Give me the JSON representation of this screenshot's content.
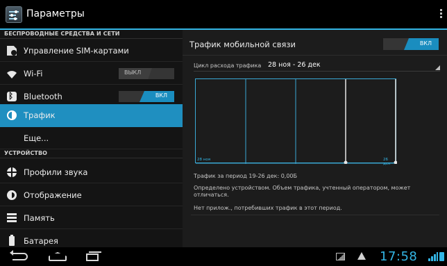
{
  "window": {
    "title": "Параметры",
    "overflow_icon": "overflow-menu-icon"
  },
  "sections": {
    "wireless": "БЕСПРОВОДНЫЕ СРЕДСТВА И СЕТИ",
    "device": "УСТРОЙСТВО"
  },
  "sidebar": {
    "sim": {
      "label": "Управление SIM-картами",
      "icon": "sim-card-icon"
    },
    "wifi": {
      "label": "Wi-Fi",
      "icon": "wifi-icon",
      "switch": "ВЫКЛ",
      "state": "off"
    },
    "bluetooth": {
      "label": "Bluetooth",
      "icon": "bluetooth-icon",
      "switch": "ВКЛ",
      "state": "on"
    },
    "traffic": {
      "label": "Трафик",
      "icon": "data-usage-icon",
      "selected": true
    },
    "more": {
      "label": "Еще..."
    },
    "sound": {
      "label": "Профили звука",
      "icon": "sound-profile-icon"
    },
    "display": {
      "label": "Отображение",
      "icon": "display-icon"
    },
    "memory": {
      "label": "Память",
      "icon": "storage-icon"
    },
    "battery": {
      "label": "Батарея",
      "icon": "battery-icon"
    }
  },
  "detail": {
    "title": "Трафик мобильной связи",
    "switch": "ВКЛ",
    "cycle_label": "Цикл расхода трафика",
    "cycle_value": "28 ноя - 26 дек",
    "chart_start": "28 ноя",
    "chart_end": "26 дек",
    "usage_text": "Трафик за период 19-26 дек: 0,00Б",
    "note_text": "Определено устройством. Объем трафика, учтенный оператором, может отличаться.",
    "apps_text": "Нет прилож., потребивших трафик в этот период."
  },
  "statusbar": {
    "time": "17:58",
    "accent": "#33b5e5",
    "icons": [
      "back-icon",
      "home-icon",
      "recent-apps-icon",
      "image-notification-icon",
      "warning-icon",
      "signal-icon",
      "battery-status-icon"
    ]
  }
}
